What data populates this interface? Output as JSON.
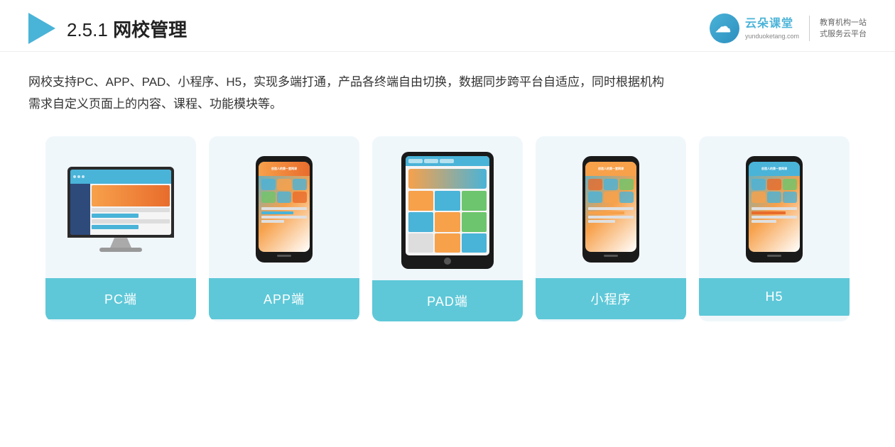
{
  "header": {
    "section_number": "2.5.1",
    "title_plain": "2.5.1 ",
    "title_bold": "网校管理",
    "brand": {
      "name": "云朵课堂",
      "domain": "yunduoketang.com",
      "slogan_line1": "教育机构一站",
      "slogan_line2": "式服务云平台"
    }
  },
  "description": {
    "line1": "网校支持PC、APP、PAD、小程序、H5，实现多端打通，产品各终端自由切换，数据同步跨平台自适应，同时根据机构",
    "line2": "需求自定义页面上的内容、课程、功能模块等。"
  },
  "cards": [
    {
      "id": "pc",
      "label": "PC端",
      "type": "monitor"
    },
    {
      "id": "app",
      "label": "APP端",
      "type": "phone"
    },
    {
      "id": "pad",
      "label": "PAD端",
      "type": "tablet"
    },
    {
      "id": "mini",
      "label": "小程序",
      "type": "phone"
    },
    {
      "id": "h5",
      "label": "H5",
      "type": "phone"
    }
  ],
  "colors": {
    "accent": "#5ec8d8",
    "accent_dark": "#4ab3d8",
    "orange": "#f7a14b",
    "card_bg": "#f0f7fb",
    "text_dark": "#222",
    "text_body": "#333"
  }
}
